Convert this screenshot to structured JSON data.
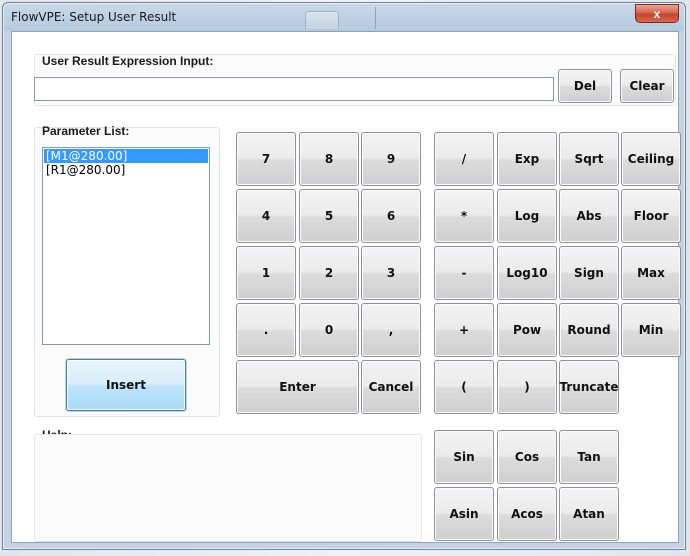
{
  "window": {
    "title": "FlowVPE: Setup User Result",
    "close_glyph": "x"
  },
  "expression": {
    "label": "User Result Expression Input:",
    "value": "",
    "del_label": "Del",
    "clear_label": "Clear"
  },
  "parameters": {
    "label": "Parameter List:",
    "items": [
      "[M1@280.00]",
      "[R1@280.00]"
    ],
    "selected_index": 0,
    "insert_label": "Insert"
  },
  "keypad": {
    "row1": [
      "7",
      "8",
      "9"
    ],
    "row2": [
      "4",
      "5",
      "6"
    ],
    "row3": [
      "1",
      "2",
      "3"
    ],
    "row4": [
      ".",
      "0",
      ","
    ],
    "enter_label": "Enter",
    "cancel_label": "Cancel"
  },
  "functions": {
    "row1": [
      "/",
      "Exp",
      "Sqrt",
      "Ceiling"
    ],
    "row2": [
      "*",
      "Log",
      "Abs",
      "Floor"
    ],
    "row3": [
      "-",
      "Log10",
      "Sign",
      "Max"
    ],
    "row4": [
      "+",
      "Pow",
      "Round",
      "Min"
    ],
    "row5": [
      "(",
      ")",
      "Truncate"
    ],
    "trig_row1": [
      "Sin",
      "Cos",
      "Tan"
    ],
    "trig_row2": [
      "Asin",
      "Acos",
      "Atan"
    ]
  },
  "help": {
    "label": "Help:",
    "text": ""
  }
}
